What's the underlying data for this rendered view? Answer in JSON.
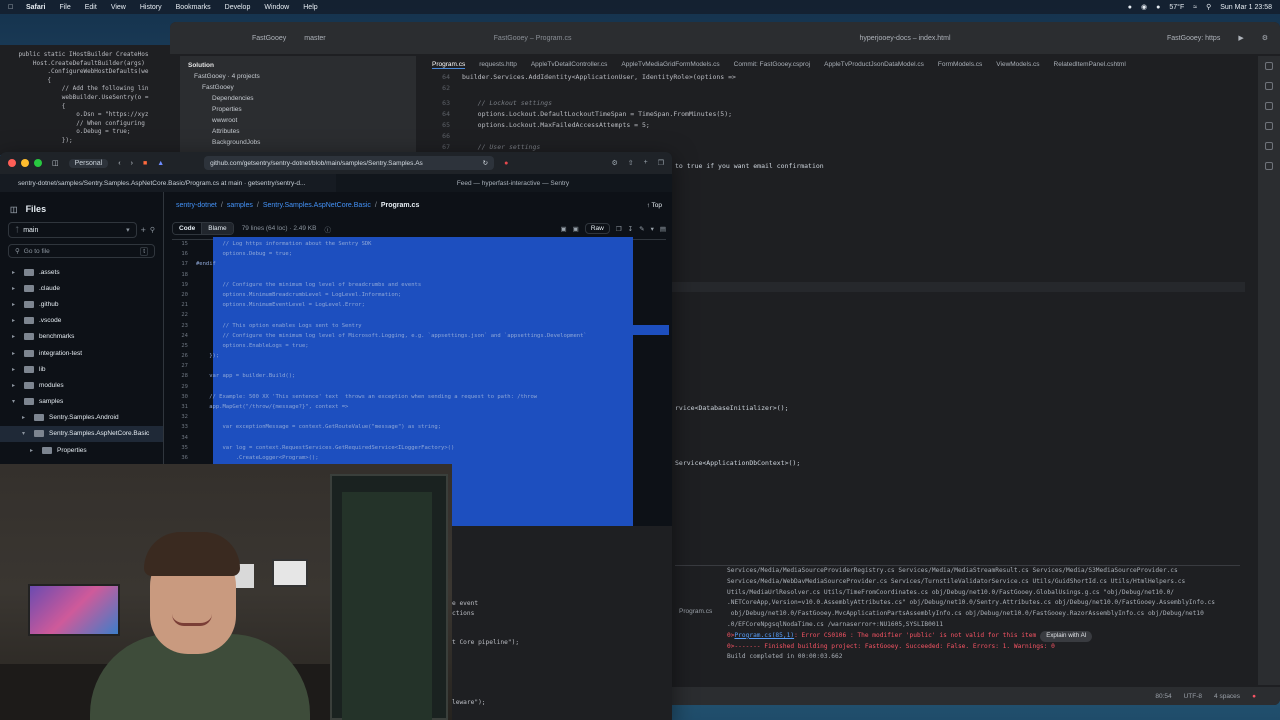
{
  "menubar": {
    "app": "Safari",
    "items": [
      "File",
      "Edit",
      "View",
      "History",
      "Bookmarks",
      "Develop",
      "Window",
      "Help"
    ],
    "weather": "57°F",
    "clock": "Sun Mar 1  23:58"
  },
  "bg_editor": {
    "lines": [
      "    public static IHostBuilder CreateHos",
      "        Host.CreateDefaultBuilder(args)",
      "            .ConfigureWebHostDefaults(we",
      "            {",
      "                // Add the following lin",
      "                webBuilder.UseSentry(o =",
      "                {",
      "                    o.Dsn = \"https://xyz",
      "                    // When configuring",
      "                    o.Debug = true;",
      "                });"
    ]
  },
  "ide": {
    "project": "FastGooey",
    "branch": "master",
    "window_title": "FastGooey – Program.cs",
    "right_title": "hyperjooey-docs – index.html",
    "run_config": "FastGooey: https",
    "solution": {
      "title": "Solution",
      "root": "FastGooey · 4 projects",
      "items": [
        "FastGooey",
        "Dependencies",
        "Properties",
        "wwwroot",
        "Attributes",
        "BackgroundJobs"
      ]
    },
    "tabs": [
      "Program.cs",
      "requests.http",
      "AppleTvDetailController.cs",
      "AppleTvMediaGridFormModels.cs",
      "Commit: FastGooey.csproj",
      "AppleTvProductJsonDataModel.cs",
      "FormModels.cs",
      "ViewModels.cs",
      "RelatedItemPanel.cshtml"
    ],
    "code_lines": [
      {
        "n": "64",
        "text": "builder.Services.AddIdentity<ApplicationUser, IdentityRole>(options =>"
      },
      {
        "n": "62",
        "text": ""
      },
      {
        "n": "63",
        "text": "    // Lockout settings"
      },
      {
        "n": "64",
        "text": "    options.Lockout.DefaultLockoutTimeSpan = TimeSpan.FromMinutes(5);"
      },
      {
        "n": "65",
        "text": "    options.Lockout.MaxFailedAccessAttempts = 5;"
      },
      {
        "n": "66",
        "text": ""
      },
      {
        "n": "67",
        "text": "    // User settings"
      }
    ],
    "code_frag_1": "to true if you want email confirmation",
    "code_frag_2": "rvice<DatabaseInitializer>();",
    "code_frag_3": "Service<ApplicationDbContext>();",
    "build": {
      "file_label": "Program.cs",
      "lines": [
        "Services/Media/MediaSourceProviderRegistry.cs Services/Media/MediaStreamResult.cs Services/Media/S3MediaSourceProvider.cs",
        "Services/Media/WebDavMediaSourceProvider.cs Services/TurnstileValidatorService.cs Utils/GuidShortId.cs Utils/HtmlHelpers.cs",
        "Utils/MediaUrlResolver.cs Utils/TimeFromCoordinates.cs obj/Debug/net10.0/FastGooey.GlobalUsings.g.cs \"obj/Debug/net10.0/",
        ".NETCoreApp,Version=v10.0.AssemblyAttributes.cs\" obj/Debug/net10.0/Sentry.Attributes.cs obj/Debug/net10.0/FastGooey.AssemblyInfo.cs",
        " obj/Debug/net10.0/FastGooey.MvcApplicationPartsAssemblyInfo.cs obj/Debug/net10.0/FastGooey.RazorAssemblyInfo.cs obj/Debug/net10",
        ".0/EFCoreNpgsqlNodaTime.cs /warnaserror+:NU1605,SYSLIB0011"
      ],
      "error_prefix": "0>",
      "error_link": "Program.cs(85,1)",
      "error_text": ": Error CS0106 : The modifier 'public' is not valid for this item",
      "explain_btn": "Explain with AI",
      "finished": "0>------- Finished building project: FastGooey. Succeeded: False. Errors: 1. Warnings: 0",
      "completed": "Build completed in 00:00:03.662"
    },
    "status": {
      "pos": "80:54",
      "enc": "UTF-8",
      "indent": "4 spaces"
    },
    "under_lines": [
      "e event",
      "ctions",
      "t Core pipeline\");",
      "leware\");"
    ]
  },
  "safari": {
    "profile": "Personal",
    "url": "github.com/getsentry/sentry-dotnet/blob/main/samples/Sentry.Samples.As",
    "tabs": [
      "sentry-dotnet/samples/Sentry.Samples.AspNetCore.Basic/Program.cs at main · getsentry/sentry-d...",
      "Feed — hyperfast-interactive — Sentry"
    ]
  },
  "github": {
    "files_title": "Files",
    "branch": "main",
    "goto_placeholder": "Go to file",
    "goto_shortcut": "t",
    "tree": [
      {
        "name": ".assets",
        "level": 0,
        "open": false
      },
      {
        "name": ".claude",
        "level": 0,
        "open": false
      },
      {
        "name": ".github",
        "level": 0,
        "open": false
      },
      {
        "name": ".vscode",
        "level": 0,
        "open": false
      },
      {
        "name": "benchmarks",
        "level": 0,
        "open": false
      },
      {
        "name": "integration-test",
        "level": 0,
        "open": false
      },
      {
        "name": "lib",
        "level": 0,
        "open": false
      },
      {
        "name": "modules",
        "level": 0,
        "open": false
      },
      {
        "name": "samples",
        "level": 0,
        "open": true
      },
      {
        "name": "Sentry.Samples.Android",
        "level": 1,
        "open": false
      },
      {
        "name": "Sentry.Samples.AspNetCore.Basic",
        "level": 1,
        "open": true
      },
      {
        "name": "Properties",
        "level": 2,
        "open": false
      }
    ],
    "breadcrumb": {
      "repo": "sentry-dotnet",
      "dir1": "samples",
      "dir2": "Sentry.Samples.AspNetCore.Basic",
      "file": "Program.cs",
      "top": "Top"
    },
    "code_tab": "Code",
    "blame_tab": "Blame",
    "file_info": "79 lines (64 loc) · 2.49 KB",
    "raw": "Raw",
    "code_lines": [
      {
        "n": "15",
        "text": "        // Log https information about the Sentry SDK"
      },
      {
        "n": "16",
        "text": "        options.Debug = true;"
      },
      {
        "n": "17",
        "text": "#endif"
      },
      {
        "n": "18",
        "text": ""
      },
      {
        "n": "19",
        "text": "        // Configure the minimum log level of breadcrumbs and events"
      },
      {
        "n": "20",
        "text": "        options.MinimumBreadcrumbLevel = LogLevel.Information;"
      },
      {
        "n": "21",
        "text": "        options.MinimumEventLevel = LogLevel.Error;"
      },
      {
        "n": "22",
        "text": ""
      },
      {
        "n": "23",
        "text": "        // This option enables Logs sent to Sentry"
      },
      {
        "n": "24",
        "text": "        // Configure the minimum log level of Microsoft.Logging, e.g. `appsettings.json` and `appsettings.Development`"
      },
      {
        "n": "25",
        "text": "        options.EnableLogs = true;"
      },
      {
        "n": "26",
        "text": "    });"
      },
      {
        "n": "27",
        "text": ""
      },
      {
        "n": "28",
        "text": "    var app = builder.Build();"
      },
      {
        "n": "29",
        "text": ""
      },
      {
        "n": "30",
        "text": "    // Example: 500 XX 'This sentence' text  throws an exception when sending a request to path: /throw"
      },
      {
        "n": "31",
        "text": "    app.MapGet(\"/throw/{message?}\", context =>"
      },
      {
        "n": "32",
        "text": ""
      },
      {
        "n": "33",
        "text": "        var exceptionMessage = context.GetRouteValue(\"message\") as string;"
      },
      {
        "n": "34",
        "text": ""
      },
      {
        "n": "35",
        "text": "        var log = context.RequestServices.GetRequiredService<ILoggerFactory>()"
      },
      {
        "n": "36",
        "text": "            .CreateLogger<Program>();"
      },
      {
        "n": "37",
        "text": ""
      }
    ]
  },
  "colors": {
    "selection": "#1d4fbf",
    "link": "#4493f8",
    "error": "#f75464"
  }
}
